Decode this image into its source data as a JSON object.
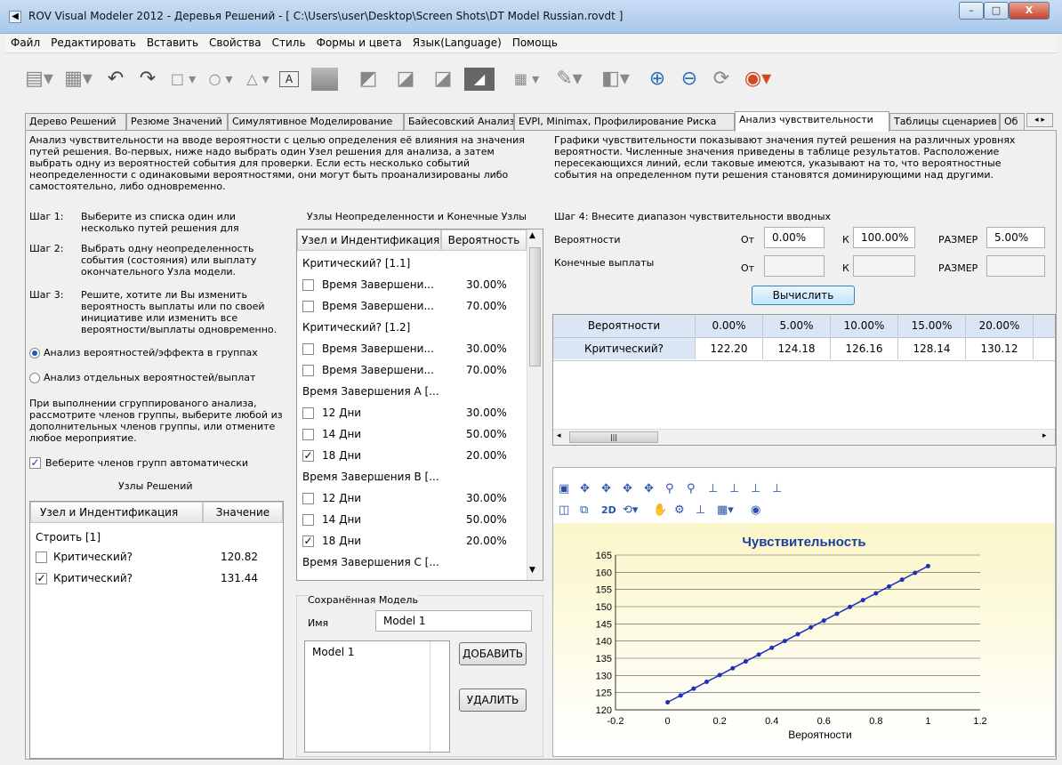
{
  "window": {
    "title": "ROV Visual Modeler 2012 - Деревья Решений - [ C:\\Users\\user\\Desktop\\Screen Shots\\DT Model Russian.rovdt ]",
    "minimize": "–",
    "maximize": "□",
    "close": "X"
  },
  "menu": [
    "Файл",
    "Редактировать",
    "Вставить",
    "Свойства",
    "Стиль",
    "Формы и цвета",
    "Язык(Language)",
    "Помощь"
  ],
  "toolbar_icons": [
    "new-file-icon",
    "copy-icon",
    "undo-icon",
    "redo-icon",
    "rectangle-icon",
    "ellipse-icon",
    "triangle-icon",
    "text-box-icon",
    "node-fill-icon",
    "chart-icon",
    "chart-icon",
    "chart-icon",
    "chart-icon",
    "calculator-icon",
    "pen-icon",
    "paint-icon",
    "zoom-in-icon",
    "zoom-out-icon",
    "refresh-icon",
    "gauge-icon"
  ],
  "tabs": [
    "Дерево Решений",
    "Резюме Значений",
    "Симулятивное Моделирование",
    "Байесовский Анализ",
    "EVPI, Minimax, Профилирование Риска",
    "Анализ чувствительности",
    "Таблицы сценариев",
    "Об"
  ],
  "active_tab": "Анализ чувствительности",
  "left_description": "Анализ чувствительности на вводе вероятности с целью определения её влияния на значения путей решения. Во-первых, ниже надо выбрать один Узел решения для анализа, а затем выбрать одну из вероятностей события для проверки. Если есть несколько событий неопределенности с одинаковыми вероятностями, они могут быть проанализированы либо самостоятельно, либо одновременно.",
  "right_description": "Графики чувствительности показывают значения путей решения на различных уровнях вероятности. Численные значения приведены в таблице результатов. Расположение пересекающихся линий, если таковые имеются, указывают на то, что вероятностные события на определенном пути решения становятся доминирующими над другими.",
  "steps": [
    {
      "label": "Шаг 1:",
      "text": "Выберите из списка один или несколько путей решения для"
    },
    {
      "label": "Шаг 2:",
      "text": "Выбрать одну неопределенность события (состояния) или выплату окончательного Узла модели."
    },
    {
      "label": "Шаг 3:",
      "text": "Решите, хотите ли Вы изменить вероятность выплаты или по своей инициативе или изменить все вероятности/выплаты одновременно."
    }
  ],
  "radio_group": "Анализ вероятностей/эффекта в группах",
  "radio_individual": "Анализ отдельных вероятностей/выплат",
  "group_note": "При выполнении сгруппированого анализа, рассмотрите членов группы, выберите любой из дополнительных членов группы, или отмените любое мероприятие.",
  "auto_select_label": "Веберите членов групп автоматически",
  "decision_nodes": {
    "title": "Узлы Решений",
    "col_node": "Узел и Индентификация",
    "col_value": "Значение",
    "group": "Строить [1]",
    "rows": [
      {
        "checked": false,
        "name": "Критический?",
        "value": "120.82"
      },
      {
        "checked": true,
        "name": "Критический?",
        "value": "131.44"
      }
    ]
  },
  "uncertainty_nodes": {
    "title": "Узлы Неопределенности и Конечные Узлы",
    "col_node": "Узел и Индентификация",
    "col_prob": "Вероятность",
    "items": [
      {
        "type": "group",
        "name": "Критический? [1.1]"
      },
      {
        "type": "row",
        "checked": false,
        "name": "Время Завершени...",
        "value": "30.00%"
      },
      {
        "type": "row",
        "checked": false,
        "name": "Время Завершени...",
        "value": "70.00%"
      },
      {
        "type": "group",
        "name": "Критический? [1.2]"
      },
      {
        "type": "row",
        "checked": false,
        "name": "Время Завершени...",
        "value": "30.00%"
      },
      {
        "type": "row",
        "checked": false,
        "name": "Время Завершени...",
        "value": "70.00%"
      },
      {
        "type": "group",
        "name": "Время Завершения А [..."
      },
      {
        "type": "row",
        "checked": false,
        "name": "12 Дни",
        "value": "30.00%"
      },
      {
        "type": "row",
        "checked": false,
        "name": "14 Дни",
        "value": "50.00%"
      },
      {
        "type": "row",
        "checked": true,
        "name": "18 Дни",
        "value": "20.00%"
      },
      {
        "type": "group",
        "name": "Время Завершения В [..."
      },
      {
        "type": "row",
        "checked": false,
        "name": "12 Дни",
        "value": "30.00%"
      },
      {
        "type": "row",
        "checked": false,
        "name": "14 Дни",
        "value": "50.00%"
      },
      {
        "type": "row",
        "checked": true,
        "name": "18 Дни",
        "value": "20.00%"
      },
      {
        "type": "group",
        "name": "Время Завершения С [..."
      }
    ]
  },
  "saved_model": {
    "title": "Сохранённая Модель",
    "name_label": "Имя",
    "name_value": "Model 1",
    "list": [
      "Model 1"
    ],
    "add_button": "ДОБАВИТЬ",
    "delete_button": "УДАЛИТЬ"
  },
  "step4": {
    "title": "Шаг 4: Внесите диапазон чувствительности вводных",
    "prob_label": "Вероятности",
    "payoff_label": "Конечные выплаты",
    "from_label": "От",
    "to_label": "К",
    "size_label": "РАЗМЕР",
    "prob_from": "0.00%",
    "prob_to": "100.00%",
    "prob_size": "5.00%",
    "payoff_from": "",
    "payoff_to": "",
    "payoff_size": "",
    "compute_button": "Вычислить"
  },
  "results": {
    "header_label": "Вероятности",
    "columns": [
      "0.00%",
      "5.00%",
      "10.00%",
      "15.00%",
      "20.00%"
    ],
    "row_label": "Критический?",
    "values": [
      "122.20",
      "124.18",
      "126.16",
      "128.14",
      "130.12"
    ]
  },
  "chart_toolbar_2d": "2D",
  "chart_data": {
    "type": "line",
    "title": "Чувствительность",
    "xlabel": "Вероятности",
    "ylabel": "",
    "xlim": [
      -0.2,
      1.2
    ],
    "ylim": [
      120,
      165
    ],
    "xticks": [
      -0.2,
      0,
      0.2,
      0.4,
      0.6,
      0.8,
      1,
      1.2
    ],
    "yticks": [
      120,
      125,
      130,
      135,
      140,
      145,
      150,
      155,
      160,
      165
    ],
    "x": [
      0,
      0.05,
      0.1,
      0.15,
      0.2,
      0.25,
      0.3,
      0.35,
      0.4,
      0.45,
      0.5,
      0.55,
      0.6,
      0.65,
      0.7,
      0.75,
      0.8,
      0.85,
      0.9,
      0.95,
      1.0
    ],
    "series": [
      {
        "values": [
          122.2,
          124.18,
          126.16,
          128.14,
          130.12,
          132.1,
          134.08,
          136.06,
          138.04,
          140.02,
          142.0,
          143.98,
          145.96,
          147.94,
          149.92,
          151.9,
          153.88,
          155.86,
          157.84,
          159.82,
          161.8
        ]
      }
    ],
    "grid": true,
    "line_color": "#1f2fb8",
    "background": "#fbf6c8"
  }
}
